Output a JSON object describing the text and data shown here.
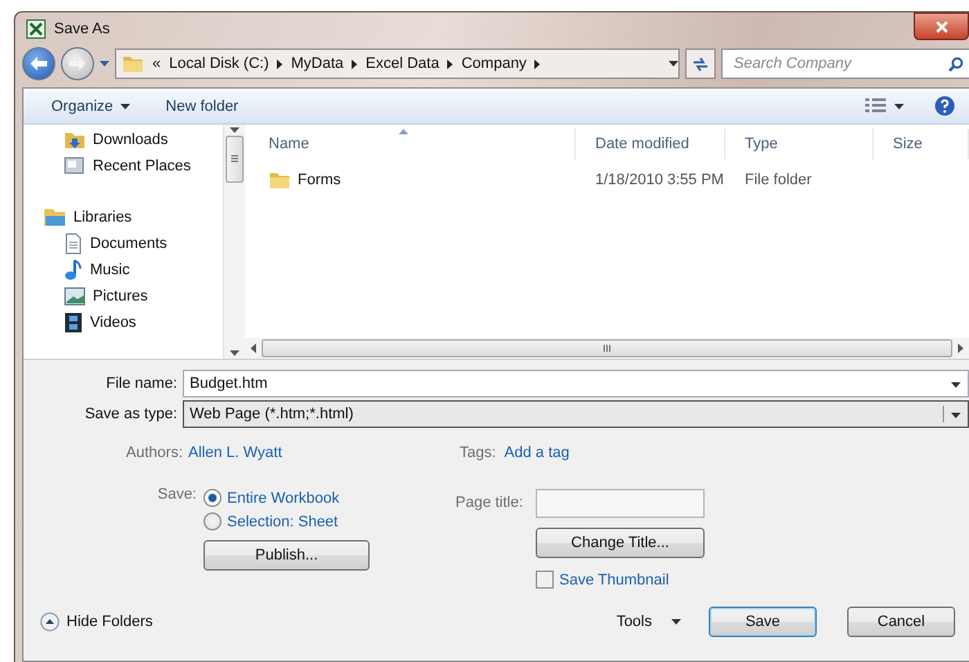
{
  "window": {
    "title": "Save As"
  },
  "address": {
    "overflow": "«",
    "crumbs": [
      "Local Disk (C:)",
      "MyData",
      "Excel Data",
      "Company"
    ]
  },
  "search": {
    "placeholder": "Search Company"
  },
  "toolbar": {
    "organize": "Organize",
    "new_folder": "New folder"
  },
  "nav": [
    {
      "items": [
        {
          "label": "Downloads",
          "kind": "downloads"
        },
        {
          "label": "Recent Places",
          "kind": "recent"
        }
      ]
    },
    {
      "label": "Libraries",
      "items": [
        {
          "label": "Documents",
          "kind": "documents"
        },
        {
          "label": "Music",
          "kind": "music"
        },
        {
          "label": "Pictures",
          "kind": "pictures"
        },
        {
          "label": "Videos",
          "kind": "videos"
        }
      ]
    }
  ],
  "columns": [
    {
      "label": "Name",
      "sorted": true
    },
    {
      "label": "Date modified",
      "sorted": false
    },
    {
      "label": "Type",
      "sorted": false
    },
    {
      "label": "Size",
      "sorted": false
    }
  ],
  "files": [
    {
      "name": "Forms",
      "date_modified": "1/18/2010 3:55 PM",
      "type": "File folder"
    }
  ],
  "form": {
    "file_name_label": "File name:",
    "file_name": "Budget.htm",
    "type_label": "Save as type:",
    "type_value": "Web Page (*.htm;*.html)",
    "authors_label": "Authors:",
    "authors": "Allen L. Wyatt",
    "tags_label": "Tags:",
    "tags": "Add a tag"
  },
  "save_options": {
    "label": "Save:",
    "options": [
      {
        "label": "Entire Workbook",
        "selected": true
      },
      {
        "label": "Selection: Sheet",
        "selected": false
      }
    ],
    "publish": "Publish..."
  },
  "page_title": {
    "label": "Page title:",
    "change": "Change Title...",
    "thumbnail": {
      "label": "Save Thumbnail",
      "checked": false
    }
  },
  "footer": {
    "hide_folders": "Hide Folders",
    "tools": "Tools",
    "save": "Save",
    "cancel": "Cancel"
  }
}
